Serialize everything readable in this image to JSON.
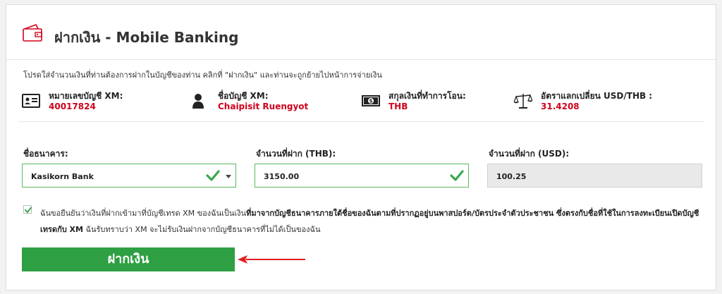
{
  "page": {
    "title": "ฝากเงิน - Mobile Banking",
    "instruction": "โปรดใส่จำนวนเงินที่ท่านต้องการฝากในบัญชีของท่าน คลิกที่ \"ฝากเงิน\" และท่านจะถูกย้ายไปหน้าการจ่ายเงิน"
  },
  "info": [
    {
      "icon": "id-card-icon",
      "label": "หมายเลขบัญชี XM:",
      "value": "40017824"
    },
    {
      "icon": "person-icon",
      "label": "ชื่อบัญชี XM:",
      "value": "Chaipisit Ruengyot"
    },
    {
      "icon": "banknote-icon",
      "label": "สกุลเงินที่ทำการโอน:",
      "value": "THB"
    },
    {
      "icon": "scales-icon",
      "label": "อัตราแลกเปลี่ยน USD/THB :",
      "value": "31.4208"
    }
  ],
  "form": {
    "bank_label": "ชื่อธนาคาร:",
    "bank_value": "Kasikorn Bank",
    "amount_thb_label": "จำนวนที่ฝาก (THB):",
    "amount_thb_value": "3150.00",
    "amount_usd_label": "จำนวนที่ฝาก (USD):",
    "amount_usd_value": "100.25"
  },
  "confirm": {
    "part1": "ฉันขอยืนยันว่าเงินที่ฝากเข้ามาที่บัญชีเทรด XM ของฉันเป็นเงิน",
    "part2_bold": "ที่มาจากบัญชีธนาคารภายใต้ชื่อของฉันตามที่ปรากฏอยู่บนพาสปอร์ต/บัตรประจำตัวประชาชน ซึ่งตรงกับชื่อที่ใช้ในการลงทะเบียนเปิดบัญชีเทรดกับ XM",
    "part3": " ฉันรับทราบว่า XM จะไม่รับเงินฝากจากบัญชีธนาคารที่ไม่ได้เป็นของฉัน",
    "checked": true
  },
  "submit_label": "ฝากเงิน",
  "colors": {
    "accent_green": "#2ea043",
    "value_red": "#d0021b",
    "arrow_red": "#e02020"
  }
}
